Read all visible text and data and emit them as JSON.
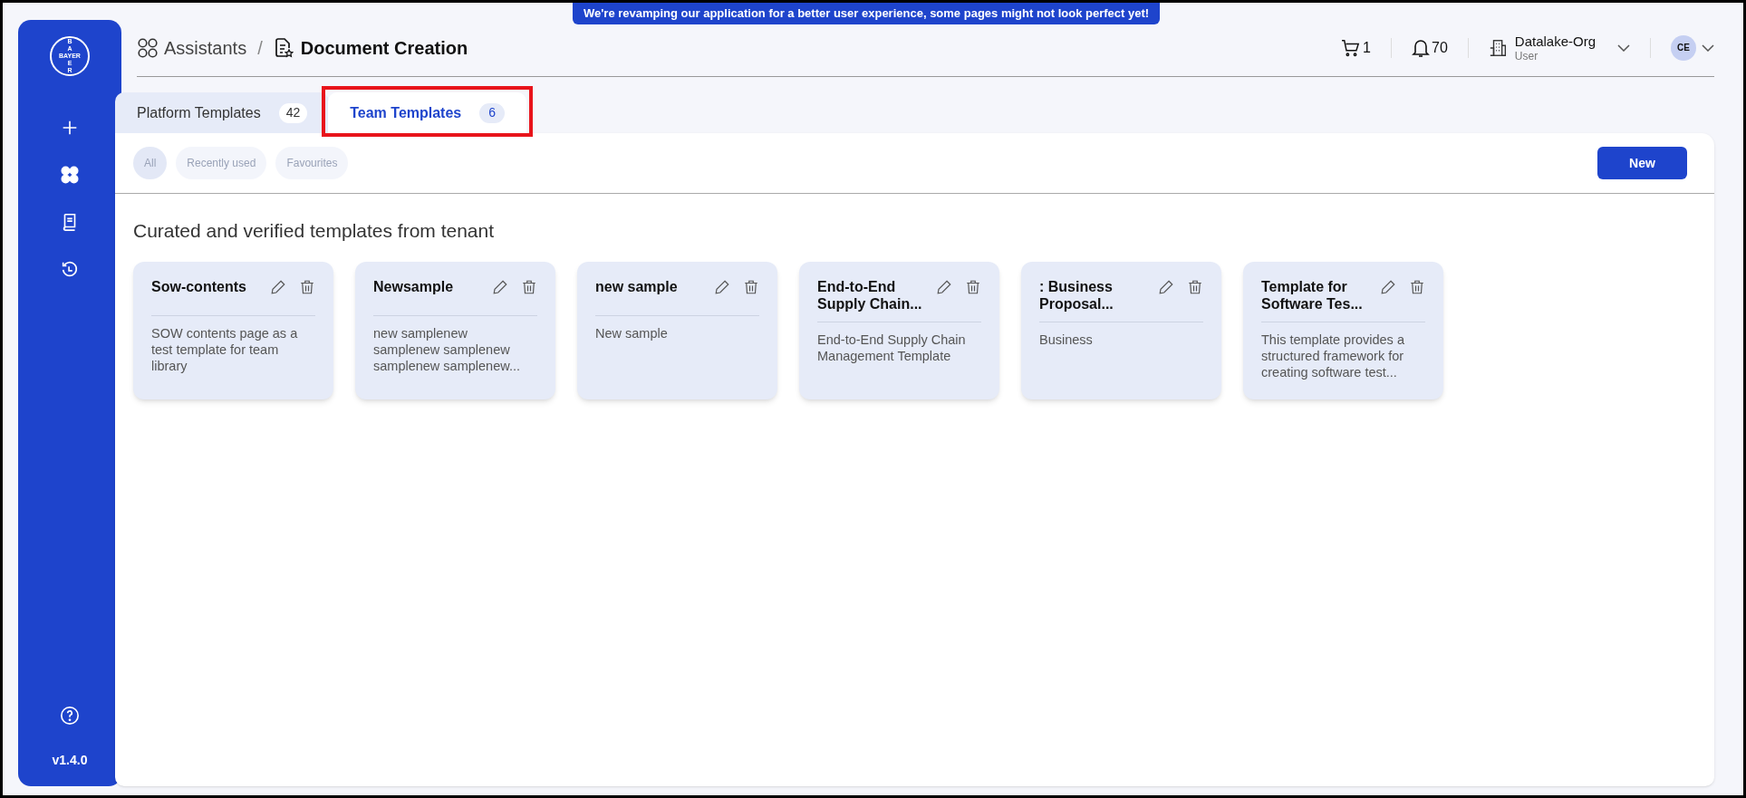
{
  "banner": "We're revamping our application for a better user experience, some pages might not look perfect yet!",
  "sidebar": {
    "logo": {
      "top": "BA",
      "middle": "BAYER",
      "bottom": "ER"
    },
    "items": [
      {
        "kind": "plus"
      },
      {
        "kind": "grid"
      },
      {
        "kind": "book"
      },
      {
        "kind": "history"
      }
    ],
    "version": "v1.4.0"
  },
  "breadcrumb": {
    "parent": "Assistants",
    "separator": "/",
    "current": "Document Creation"
  },
  "header": {
    "cart_count": "1",
    "notification_count": "70",
    "org_name": "Datalake-Org",
    "org_role": "User",
    "avatar": "CE"
  },
  "tabs": [
    {
      "label": "Platform Templates",
      "count": "42",
      "selected": false,
      "highlighted": false
    },
    {
      "label": "Team Templates",
      "count": "6",
      "selected": true,
      "highlighted": true
    }
  ],
  "filters": [
    {
      "label": "All",
      "selected": true
    },
    {
      "label": "Recently used",
      "selected": false
    },
    {
      "label": "Favourites",
      "selected": false
    }
  ],
  "new_button": "New",
  "section_title": "Curated and verified templates from tenant",
  "cards": [
    {
      "title": "Sow-contents",
      "description": "SOW contents page as a test template for team library"
    },
    {
      "title": "Newsample",
      "description": "new samplenew samplenew samplenew samplenew samplenew..."
    },
    {
      "title": "new sample",
      "description": "New sample"
    },
    {
      "title": "End-to-End Supply Chain...",
      "description": "End-to-End Supply Chain Management Template"
    },
    {
      "title": ": Business Proposal...",
      "description": "Business"
    },
    {
      "title": "Template for Software Tes...",
      "description": "This template provides a structured framework for creating software test..."
    }
  ]
}
